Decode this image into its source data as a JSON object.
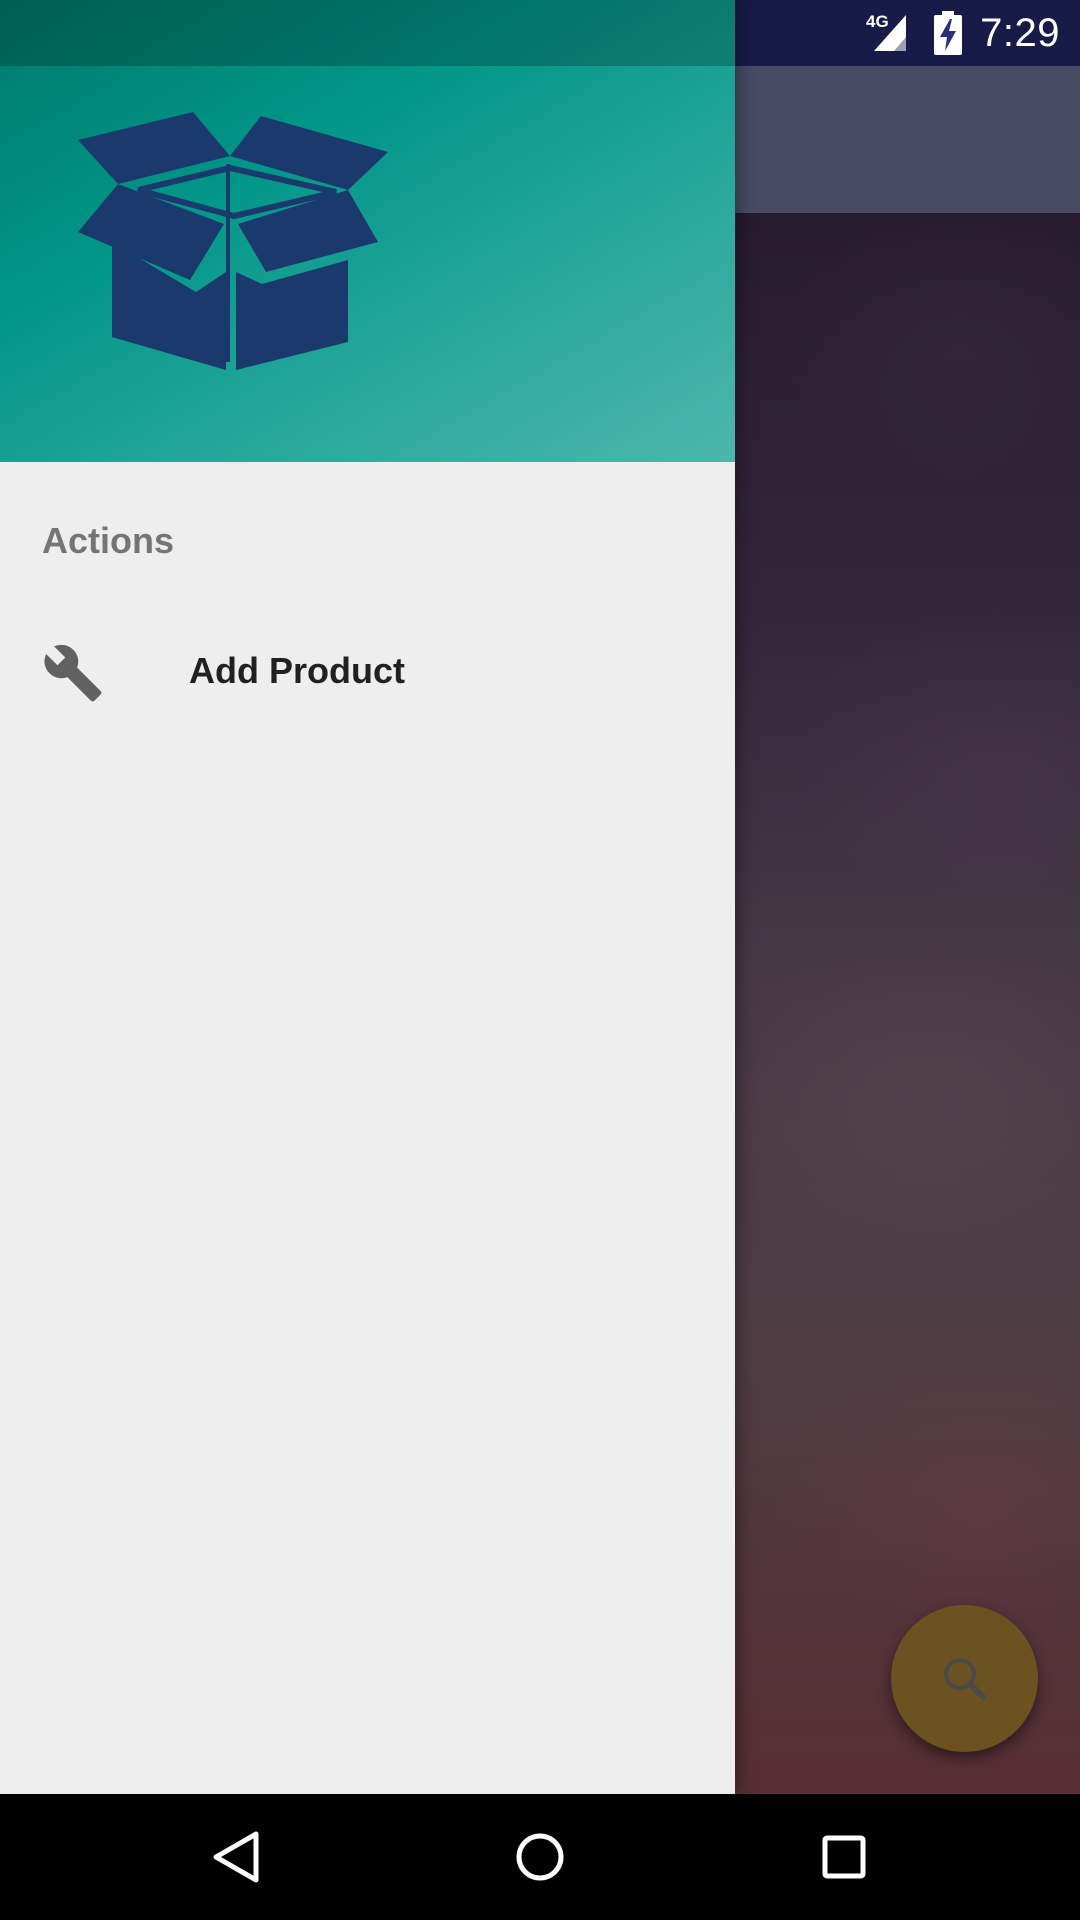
{
  "status_bar": {
    "time": "7:29",
    "network_label": "4G",
    "icons": [
      "signal-icon",
      "battery-charging-icon"
    ]
  },
  "drawer": {
    "header": {
      "logo": "open-box-icon",
      "colors": {
        "start": "#00796b",
        "end": "#4db6ac",
        "logo": "#1a3a6e"
      }
    },
    "section_label": "Actions",
    "items": [
      {
        "label": "Add Product",
        "icon": "wrench-icon"
      }
    ],
    "background": "#eeeeee"
  },
  "fab": {
    "icon": "search-icon",
    "color": "#6b5220"
  },
  "navigation_bar": {
    "buttons": [
      "back-icon",
      "home-icon",
      "recents-icon"
    ]
  }
}
